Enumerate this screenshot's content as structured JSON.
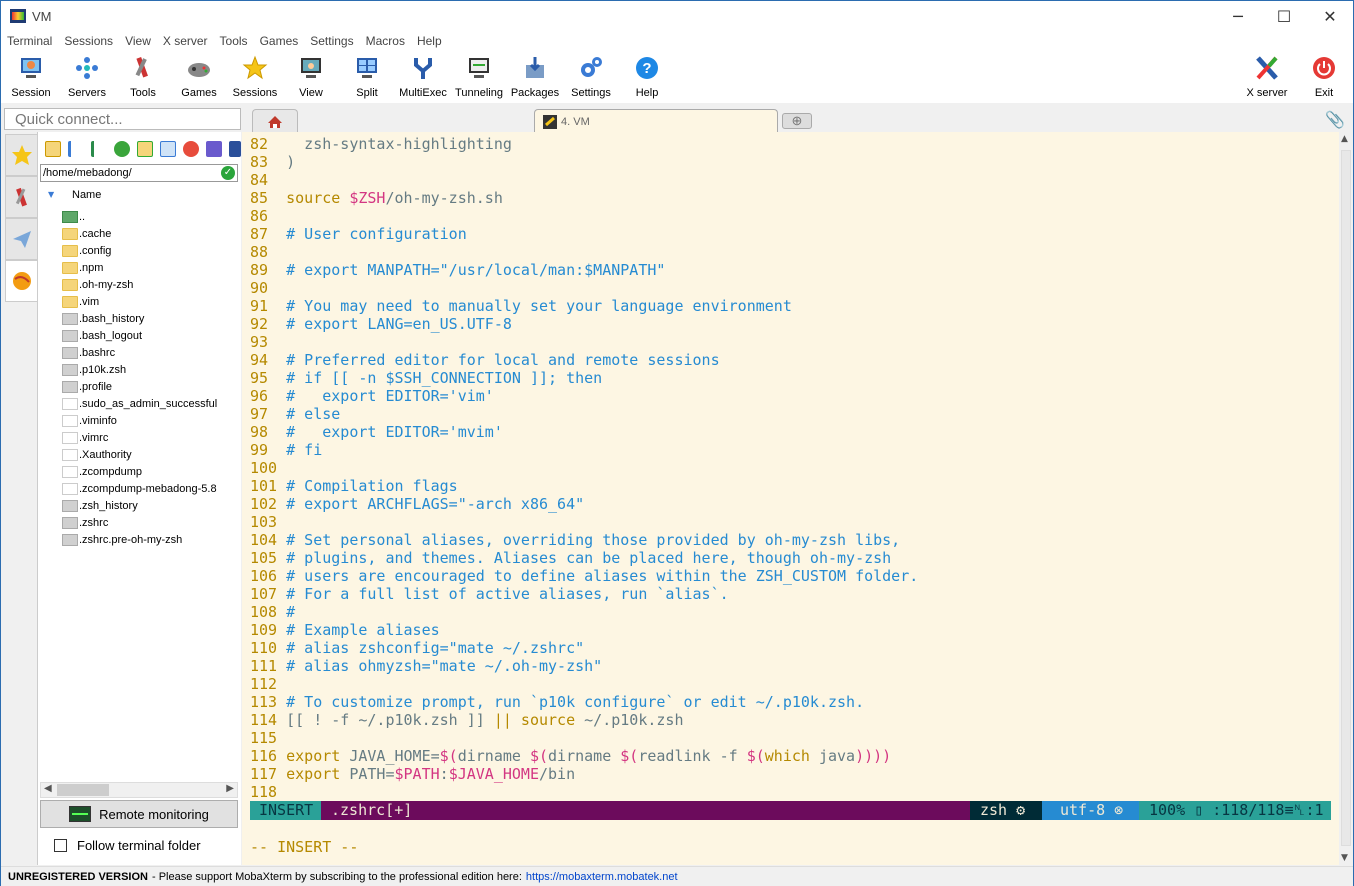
{
  "window": {
    "title": "VM"
  },
  "menu": [
    "Terminal",
    "Sessions",
    "View",
    "X server",
    "Tools",
    "Games",
    "Settings",
    "Macros",
    "Help"
  ],
  "toolbar": {
    "buttons": [
      "Session",
      "Servers",
      "Tools",
      "Games",
      "Sessions",
      "View",
      "Split",
      "MultiExec",
      "Tunneling",
      "Packages",
      "Settings",
      "Help"
    ],
    "right_buttons": [
      "X server",
      "Exit"
    ]
  },
  "quick_connect": {
    "placeholder": "Quick connect..."
  },
  "tabs": {
    "active_label": "4. VM"
  },
  "sidebar": {
    "path": "/home/mebadong/",
    "column_header": "Name",
    "files": [
      {
        "name": "..",
        "kind": "up"
      },
      {
        "name": ".cache",
        "kind": "folder"
      },
      {
        "name": ".config",
        "kind": "folder"
      },
      {
        "name": ".npm",
        "kind": "folder"
      },
      {
        "name": ".oh-my-zsh",
        "kind": "folder"
      },
      {
        "name": ".vim",
        "kind": "folder"
      },
      {
        "name": ".bash_history",
        "kind": "doc"
      },
      {
        "name": ".bash_logout",
        "kind": "doc"
      },
      {
        "name": ".bashrc",
        "kind": "doc"
      },
      {
        "name": ".p10k.zsh",
        "kind": "doc"
      },
      {
        "name": ".profile",
        "kind": "doc"
      },
      {
        "name": ".sudo_as_admin_successful",
        "kind": "blank"
      },
      {
        "name": ".viminfo",
        "kind": "blank"
      },
      {
        "name": ".vimrc",
        "kind": "blank"
      },
      {
        "name": ".Xauthority",
        "kind": "blank"
      },
      {
        "name": ".zcompdump",
        "kind": "blank"
      },
      {
        "name": ".zcompdump-mebadong-5.8",
        "kind": "blank"
      },
      {
        "name": ".zsh_history",
        "kind": "doc"
      },
      {
        "name": ".zshrc",
        "kind": "doc"
      },
      {
        "name": ".zshrc.pre-oh-my-zsh",
        "kind": "doc"
      }
    ],
    "remote_monitoring_label": "Remote monitoring",
    "follow_terminal_label": "Follow terminal folder"
  },
  "terminal": {
    "lines": [
      {
        "n": "82",
        "segs": [
          [
            "tx",
            "  zsh-syntax-highlighting"
          ]
        ]
      },
      {
        "n": "83",
        "segs": [
          [
            "tx",
            ")"
          ]
        ]
      },
      {
        "n": "84",
        "segs": []
      },
      {
        "n": "85",
        "segs": [
          [
            "kw",
            "source "
          ],
          [
            "vr",
            "$ZSH"
          ],
          [
            "tx",
            "/oh-my-zsh.sh"
          ]
        ]
      },
      {
        "n": "86",
        "segs": []
      },
      {
        "n": "87",
        "segs": [
          [
            "cm",
            "# User configuration"
          ]
        ]
      },
      {
        "n": "88",
        "segs": []
      },
      {
        "n": "89",
        "segs": [
          [
            "cm",
            "# export MANPATH=\"/usr/local/man:$MANPATH\""
          ]
        ]
      },
      {
        "n": "90",
        "segs": []
      },
      {
        "n": "91",
        "segs": [
          [
            "cm",
            "# You may need to manually set your language environment"
          ]
        ]
      },
      {
        "n": "92",
        "segs": [
          [
            "cm",
            "# export LANG=en_US.UTF-8"
          ]
        ]
      },
      {
        "n": "93",
        "segs": []
      },
      {
        "n": "94",
        "segs": [
          [
            "cm",
            "# Preferred editor for local and remote sessions"
          ]
        ]
      },
      {
        "n": "95",
        "segs": [
          [
            "cm",
            "# if [[ -n $SSH_CONNECTION ]]; then"
          ]
        ]
      },
      {
        "n": "96",
        "segs": [
          [
            "cm",
            "#   export EDITOR='vim'"
          ]
        ]
      },
      {
        "n": "97",
        "segs": [
          [
            "cm",
            "# else"
          ]
        ]
      },
      {
        "n": "98",
        "segs": [
          [
            "cm",
            "#   export EDITOR='mvim'"
          ]
        ]
      },
      {
        "n": "99",
        "segs": [
          [
            "cm",
            "# fi"
          ]
        ]
      },
      {
        "n": "100",
        "segs": []
      },
      {
        "n": "101",
        "segs": [
          [
            "cm",
            "# Compilation flags"
          ]
        ]
      },
      {
        "n": "102",
        "segs": [
          [
            "cm",
            "# export ARCHFLAGS=\"-arch x86_64\""
          ]
        ]
      },
      {
        "n": "103",
        "segs": []
      },
      {
        "n": "104",
        "segs": [
          [
            "cm",
            "# Set personal aliases, overriding those provided by oh-my-zsh libs,"
          ]
        ]
      },
      {
        "n": "105",
        "segs": [
          [
            "cm",
            "# plugins, and themes. Aliases can be placed here, though oh-my-zsh"
          ]
        ]
      },
      {
        "n": "106",
        "segs": [
          [
            "cm",
            "# users are encouraged to define aliases within the ZSH_CUSTOM folder."
          ]
        ]
      },
      {
        "n": "107",
        "segs": [
          [
            "cm",
            "# For a full list of active aliases, run `alias`."
          ]
        ]
      },
      {
        "n": "108",
        "segs": [
          [
            "cm",
            "#"
          ]
        ]
      },
      {
        "n": "109",
        "segs": [
          [
            "cm",
            "# Example aliases"
          ]
        ]
      },
      {
        "n": "110",
        "segs": [
          [
            "cm",
            "# alias zshconfig=\"mate ~/.zshrc\""
          ]
        ]
      },
      {
        "n": "111",
        "segs": [
          [
            "cm",
            "# alias ohmyzsh=\"mate ~/.oh-my-zsh\""
          ]
        ]
      },
      {
        "n": "112",
        "segs": []
      },
      {
        "n": "113",
        "segs": [
          [
            "cm",
            "# To customize prompt, run `p10k configure` or edit ~/.p10k.zsh."
          ]
        ]
      },
      {
        "n": "114",
        "segs": [
          [
            "tx",
            "[[ ! -f ~/.p10k.zsh ]] "
          ],
          [
            "kw",
            "|| source"
          ],
          [
            "tx",
            " ~/.p10k.zsh"
          ]
        ]
      },
      {
        "n": "115",
        "segs": []
      },
      {
        "n": "116",
        "segs": [
          [
            "kw",
            "export "
          ],
          [
            "tx",
            "JAVA_HOME="
          ],
          [
            "vr",
            "$("
          ],
          [
            "tx",
            "dirname "
          ],
          [
            "vr",
            "$("
          ],
          [
            "tx",
            "dirname "
          ],
          [
            "vr",
            "$("
          ],
          [
            "tx",
            "readlink -f "
          ],
          [
            "vr",
            "$("
          ],
          [
            "kw",
            "which"
          ],
          [
            "tx",
            " java"
          ],
          [
            "vr",
            "))))"
          ]
        ]
      },
      {
        "n": "117",
        "segs": [
          [
            "kw",
            "export "
          ],
          [
            "tx",
            "PATH="
          ],
          [
            "vr",
            "$PATH"
          ],
          [
            "tx",
            ":"
          ],
          [
            "vr",
            "$JAVA_HOME"
          ],
          [
            "tx",
            "/bin"
          ]
        ]
      },
      {
        "n": "118",
        "segs": []
      }
    ],
    "status": {
      "mode": "INSERT",
      "file": ".zshrc[+]",
      "shell": "zsh ⚙",
      "encoding": "utf-8 ⊗",
      "position": "100% ▯ :118/118≡␤:1"
    },
    "insert_line": "-- INSERT --"
  },
  "statusbar": {
    "unregistered": "UNREGISTERED VERSION",
    "message": " -  Please support MobaXterm by subscribing to the professional edition here:",
    "link": "https://mobaxterm.mobatek.net"
  },
  "colors": {
    "terminal_bg": "#fdf6e3",
    "line_number": "#b58900",
    "comment": "#268bd2",
    "text": "#657b83",
    "variable": "#d33682",
    "status_mode_bg": "#2aa198",
    "status_file_bg": "#6c0b5c"
  }
}
